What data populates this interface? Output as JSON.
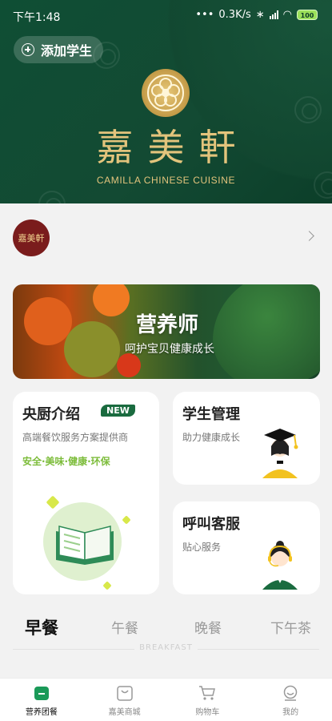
{
  "status_bar": {
    "time": "下午1:48",
    "network_speed": "0.3K/s",
    "battery": "100"
  },
  "header": {
    "add_student_label": "添加学生",
    "brand_cn": "嘉美軒",
    "brand_en": "CAMILLA CHINESE CUISINE"
  },
  "store": {
    "avatar_text": "嘉美軒"
  },
  "banner": {
    "title": "营养师",
    "subtitle": "呵护宝贝健康成长"
  },
  "cards": {
    "intro": {
      "title": "央厨介绍",
      "badge": "NEW",
      "subtitle": "高端餐饮服务方案提供商",
      "slogan": "安全·美味·健康·环保"
    },
    "student": {
      "title": "学生管理",
      "subtitle": "助力健康成长"
    },
    "service": {
      "title": "呼叫客服",
      "subtitle": "贴心服务"
    }
  },
  "meal_tabs": {
    "items": [
      "早餐",
      "午餐",
      "晚餐",
      "下午茶"
    ],
    "active": "早餐",
    "active_en": "BREAKFAST"
  },
  "bottom_nav": {
    "items": [
      {
        "label": "营养团餐",
        "icon": "meal-bag-icon",
        "active": true
      },
      {
        "label": "嘉美商城",
        "icon": "shop-bag-icon",
        "active": false
      },
      {
        "label": "购物车",
        "icon": "cart-icon",
        "active": false
      },
      {
        "label": "我的",
        "icon": "profile-icon",
        "active": false
      }
    ]
  },
  "colors": {
    "brand_green": "#134a33",
    "gold": "#e3c47c",
    "accent_green": "#1a6b3f",
    "slogan_green": "#7cbc3a"
  }
}
